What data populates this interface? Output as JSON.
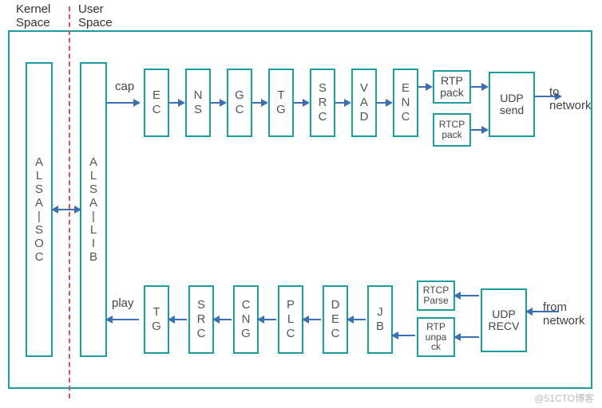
{
  "headers": {
    "kernel": "Kernel\nSpace",
    "user": "User\nSpace"
  },
  "left": {
    "alsa_soc": "ALSA|SOC",
    "alsa_lib": "ALSA|LIB"
  },
  "top": {
    "cap_label": "cap",
    "blocks": {
      "ec": "EC",
      "ns": "NS",
      "gc": "GC",
      "tg": "TG",
      "src": "SRC",
      "vad": "VAD",
      "enc": "ENC"
    },
    "rtp_pack": "RTP\npack",
    "rtcp_pack": "RTCP\npack",
    "udp_send": "UDP\nsend",
    "to_network": "to\nnetwork"
  },
  "bottom": {
    "play_label": "play",
    "blocks": {
      "tg": "TG",
      "src": "SRC",
      "cng": "CNG",
      "plc": "PLC",
      "dec": "DEC",
      "jb": "JB"
    },
    "rtp_unpack": "RTP\nunpa\nck",
    "rtcp_parse": "RTCP\nParse",
    "udp_recv": "UDP\nRECV",
    "from_network": "from\nnetwork"
  },
  "watermark": "@51CTO博客"
}
